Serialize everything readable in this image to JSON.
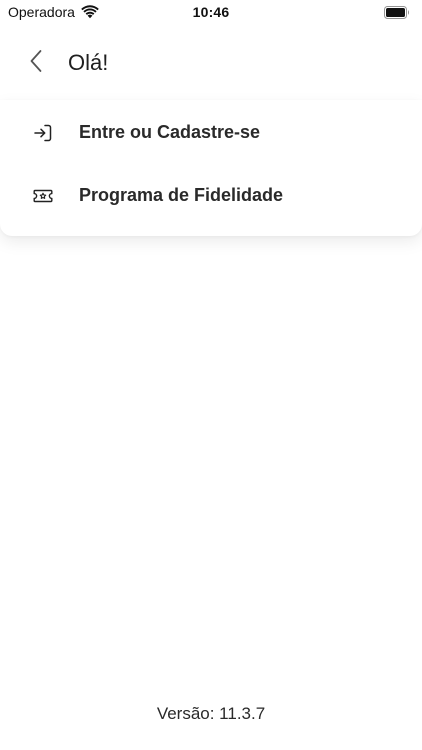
{
  "status_bar": {
    "carrier": "Operadora",
    "time": "10:46",
    "wifi_icon": "wifi-icon",
    "battery_icon": "battery-icon"
  },
  "header": {
    "back_icon": "chevron-left-icon",
    "title": "Olá!"
  },
  "menu": {
    "items": [
      {
        "label": "Entre ou Cadastre-se",
        "icon": "login-icon"
      },
      {
        "label": "Programa de Fidelidade",
        "icon": "loyalty-ticket-icon"
      }
    ]
  },
  "footer": {
    "version": "Versão: 11.3.7"
  }
}
